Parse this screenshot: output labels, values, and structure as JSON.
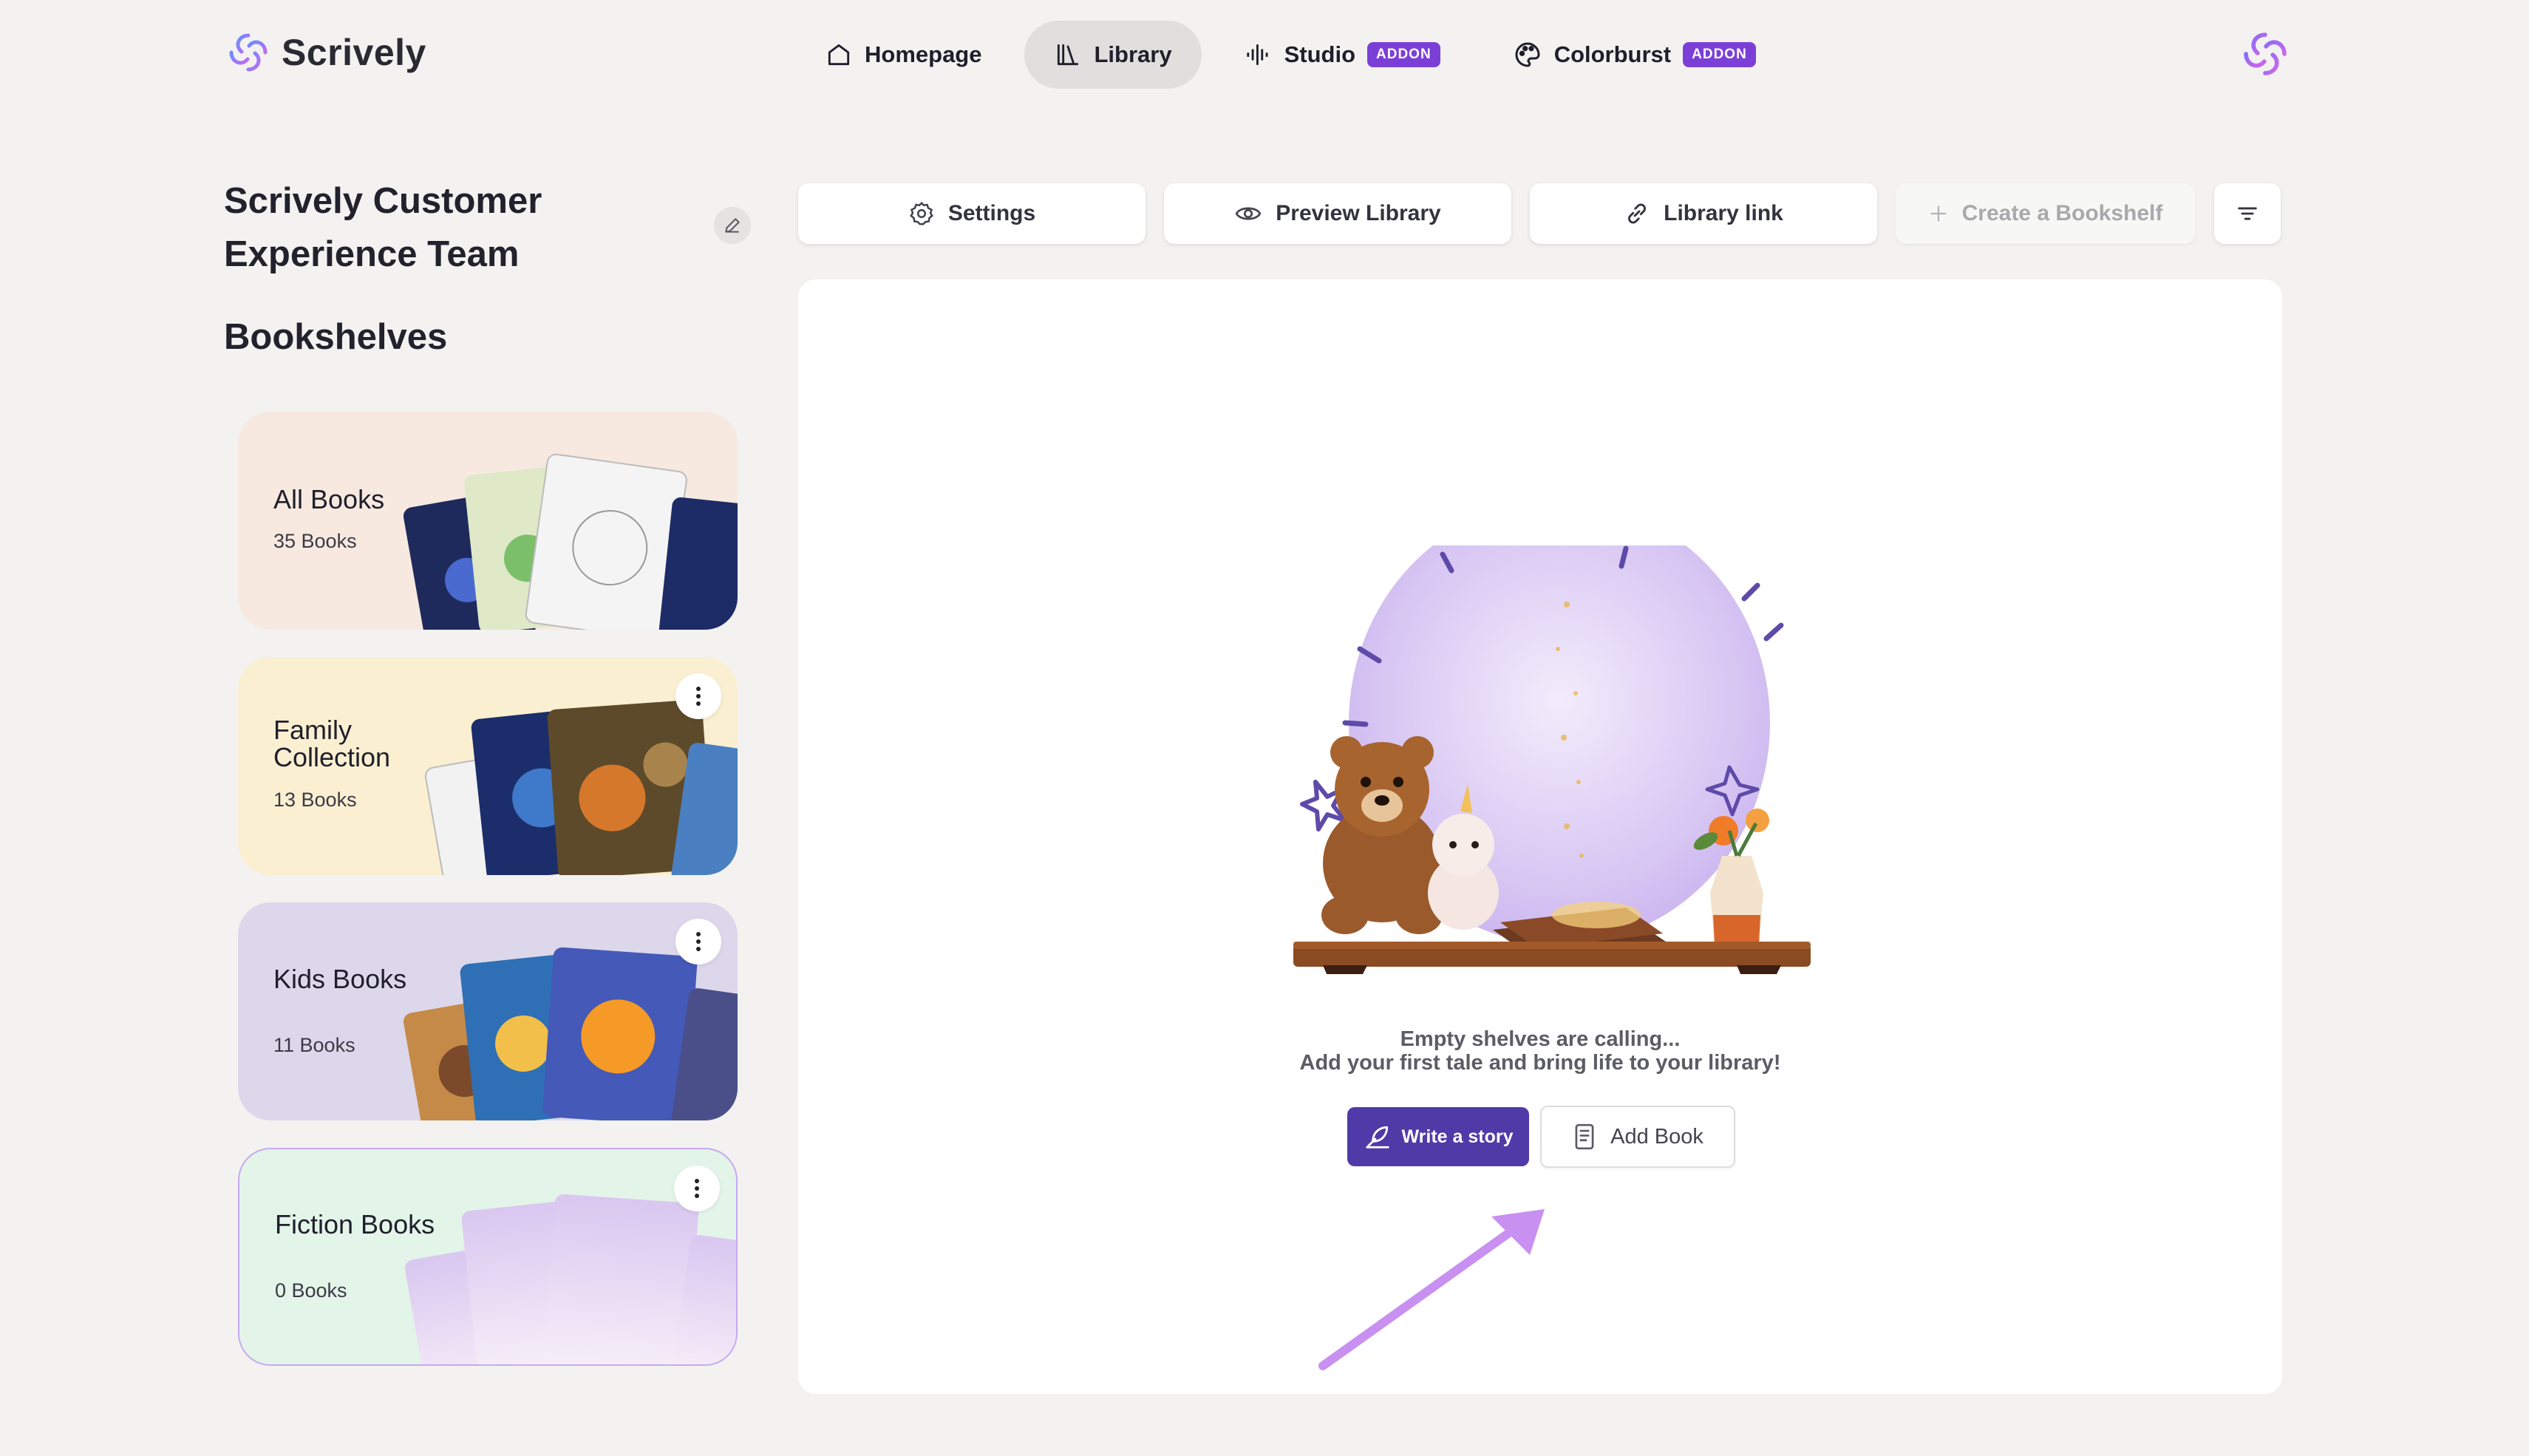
{
  "app": {
    "name": "Scrively"
  },
  "nav": {
    "items": [
      {
        "label": "Homepage",
        "icon": "home-icon",
        "active": false
      },
      {
        "label": "Library",
        "icon": "library-icon",
        "active": true
      },
      {
        "label": "Studio",
        "icon": "audio-wave-icon",
        "badge": "ADDON",
        "active": false
      },
      {
        "label": "Colorburst",
        "icon": "palette-icon",
        "badge": "ADDON",
        "active": false
      }
    ]
  },
  "sidebar": {
    "team_name": "Scrively Customer Experience Team",
    "section_title": "Bookshelves",
    "shelves": [
      {
        "name": "All Books",
        "count": "35 Books",
        "bg": "#f7e9e0"
      },
      {
        "name": "Family Collection",
        "count": "13 Books",
        "bg": "#fbefd2"
      },
      {
        "name": "Kids Books",
        "count": "11 Books",
        "bg": "#dcd7ea"
      },
      {
        "name": "Fiction Books",
        "count": "0 Books",
        "bg": "#e3f4e9"
      }
    ]
  },
  "toolbar": {
    "settings": "Settings",
    "preview": "Preview Library",
    "link": "Library link",
    "create": "Create a Bookshelf"
  },
  "empty_state": {
    "line1": "Empty shelves are calling...",
    "line2": "Add your first tale and bring life to your library!",
    "write_label": "Write a story",
    "add_label": "Add Book"
  },
  "colors": {
    "accent": "#4f3aa8",
    "addon": "#7b3fd8",
    "brand": "#8b5cf6"
  }
}
